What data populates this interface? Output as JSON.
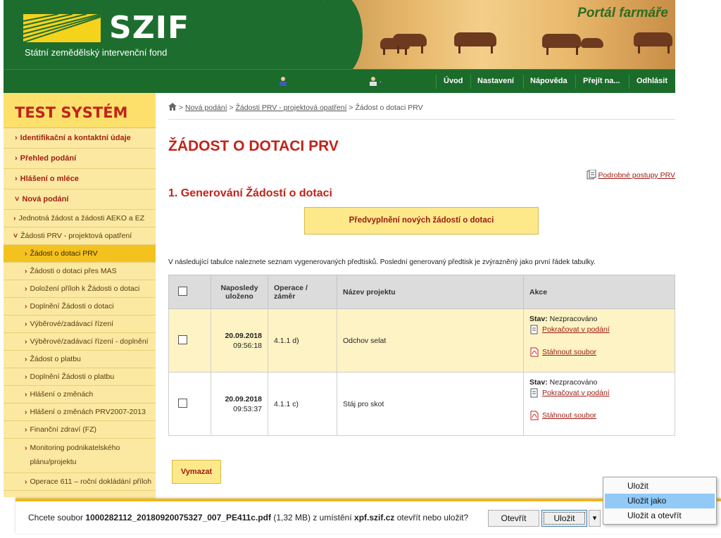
{
  "header": {
    "brand": "SZIF",
    "brand_subtitle": "Státní zemědělský intervenční fond",
    "portal_title": "Portál farmáře"
  },
  "topnav": {
    "items": [
      {
        "label": "Úvod"
      },
      {
        "label": "Nastavení"
      },
      {
        "label": "Nápověda"
      },
      {
        "label": "Přejít na..."
      },
      {
        "label": "Odhlásit"
      }
    ],
    "user_icon_1": "user-icon",
    "user_icon_2": "user-icon",
    "dot": "."
  },
  "sidebar": {
    "title": "TEST SYSTÉM",
    "items": [
      {
        "label": "Identifikační a kontaktní údaje"
      },
      {
        "label": "Přehled podání"
      },
      {
        "label": "Hlášení o mléce"
      },
      {
        "label": "Nová podání"
      }
    ],
    "subitems": [
      {
        "label": "Jednotná žádost a žádosti AEKO a EZ"
      },
      {
        "label": "Žádosti PRV - projektová opatření"
      }
    ],
    "subsubitems": [
      {
        "label": "Žádost o dotaci PRV"
      },
      {
        "label": "Žádosti o dotaci přes MAS"
      },
      {
        "label": "Doložení příloh k Žádosti o dotaci"
      },
      {
        "label": "Doplnění Žádosti o dotaci"
      },
      {
        "label": "Výběrové/zadávací řízení"
      },
      {
        "label": "Výběrové/zadávací řízení - doplnění"
      },
      {
        "label": "Žádost o platbu"
      },
      {
        "label": "Doplnění Žádosti o platbu"
      },
      {
        "label": "Hlášení o změnách"
      },
      {
        "label": "Hlášení o změnách PRV2007-2013"
      },
      {
        "label": "Finanční zdraví (FZ)"
      },
      {
        "label": "Monitoring podnikatelského plánu/projektu"
      },
      {
        "label": "Operace 611 – roční dokládání příloh"
      }
    ]
  },
  "breadcrumb": {
    "links": [
      "Nová podání",
      "Žádosti PRV - projektová opatření"
    ],
    "current": "Žádost o dotaci PRV"
  },
  "main": {
    "title": "ŽÁDOST O DOTACI PRV",
    "help_link": "Podrobné postupy PRV",
    "section_title": "1. Generování Žádostí o dotaci",
    "prefill_button": "Předvyplnění nových žádostí o dotaci",
    "info_text": "V následující tabulce naleznete seznam vygenerovaných předtisků. Poslední generovaný předtisk je zvýrazněný jako první řádek tabulky.",
    "delete_button": "Vymazat"
  },
  "table": {
    "headers": {
      "saved": "Naposledy uloženo",
      "operation": "Operace / záměr",
      "project": "Název projektu",
      "actions": "Akce"
    },
    "rows": [
      {
        "date": "20.09.2018",
        "time": "09:56:18",
        "operation": "4.1.1 d)",
        "project": "Odchov selat",
        "status_label": "Stav:",
        "status": "Nezpracováno",
        "continue": "Pokračovat v podání",
        "download": "Stáhnout soubor"
      },
      {
        "date": "20.09.2018",
        "time": "09:53:37",
        "operation": "4.1.1 c)",
        "project": "Stáj pro skot",
        "status_label": "Stav:",
        "status": "Nezpracováno",
        "continue": "Pokračovat v podání",
        "download": "Stáhnout soubor"
      }
    ]
  },
  "download_bar": {
    "prefix": "Chcete soubor ",
    "filename": "1000282112_20180920075327_007_PE411c.pdf",
    "size": " (1,32 MB) z umístění ",
    "host": "xpf.szif.cz",
    "suffix": " otevřít nebo uložit?",
    "open_button": "Otevřít",
    "save_button": "Uložit",
    "dropdown_arrow": "▾"
  },
  "save_menu": {
    "items": [
      "Uložit",
      "Uložit jako",
      "Uložit a otevřít"
    ],
    "selected": "Uložit jako"
  },
  "colors": {
    "green": "#1d6e2e",
    "accent_red": "#c0241b",
    "yellow": "#fde98a"
  }
}
